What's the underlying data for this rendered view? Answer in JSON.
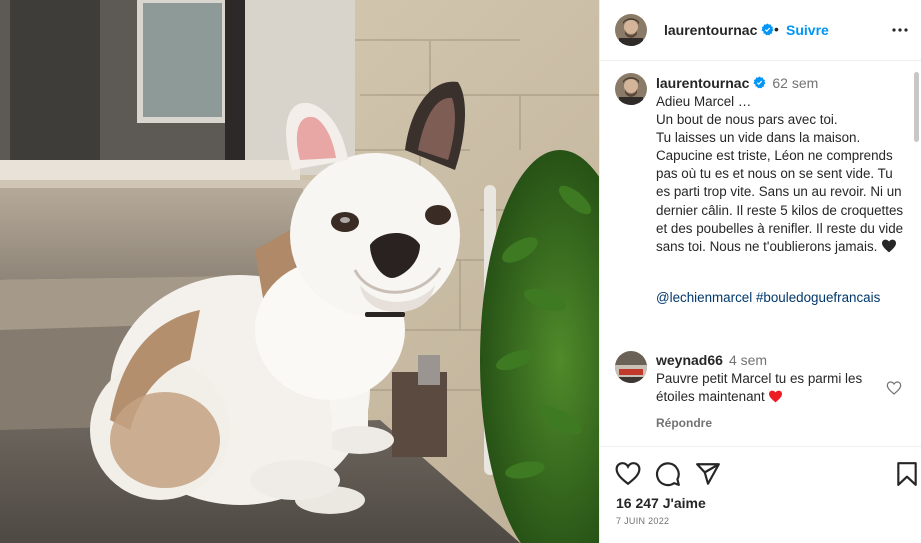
{
  "post": {
    "username": "laurentournac",
    "follow_label": "Suivre",
    "separator": "•",
    "caption_time": "62 sem",
    "caption_text": "Adieu Marcel …\nUn bout de nous pars avec toi.\nTu laisses un vide dans la maison.\nCapucine est triste, Léon ne comprends pas où tu es et nous on se sent vide. Tu es parti trop vite. Sans un au revoir. Ni un dernier câlin. Il reste 5 kilos de croquettes et des poubelles à renifler. Il reste du vide sans toi. Nous ne t'oublierons jamais.",
    "caption_emoji": "black-heart-icon",
    "hashtags": [
      "@lechienmarcel",
      "#bouledoguefrancais"
    ],
    "likes": "16 247 J'aime",
    "date": "7 juin 2022"
  },
  "comment": {
    "username": "weynad66",
    "time": "4 sem",
    "text": "Pauvre petit Marcel tu es parmi les étoiles maintenant",
    "emoji": "red-heart-icon",
    "reply_label": "Répondre"
  },
  "colors": {
    "accent": "#0095f6",
    "verified": "#0095f6",
    "hashtag": "#00376b",
    "muted": "#737373",
    "heart_red": "#ed1c24"
  },
  "icons": [
    "verified-badge-icon",
    "more-options-icon",
    "heart-outline-icon",
    "comment-icon",
    "share-icon",
    "bookmark-icon"
  ]
}
